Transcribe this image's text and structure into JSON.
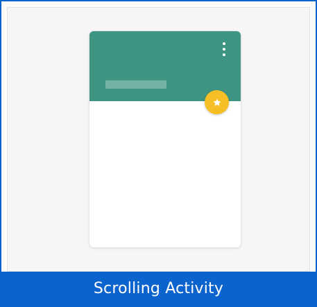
{
  "tile": {
    "caption": "Scrolling Activity"
  },
  "preview": {
    "app_bar": {
      "title_placeholder": "",
      "overflow_icon": "more-vert-icon"
    },
    "fab_icon": "star-icon"
  },
  "colors": {
    "border": "#0b63ce",
    "caption_bar": "#0b63ce",
    "app_bar": "#3f9583",
    "fab": "#f6bf26",
    "card": "#ffffff"
  }
}
